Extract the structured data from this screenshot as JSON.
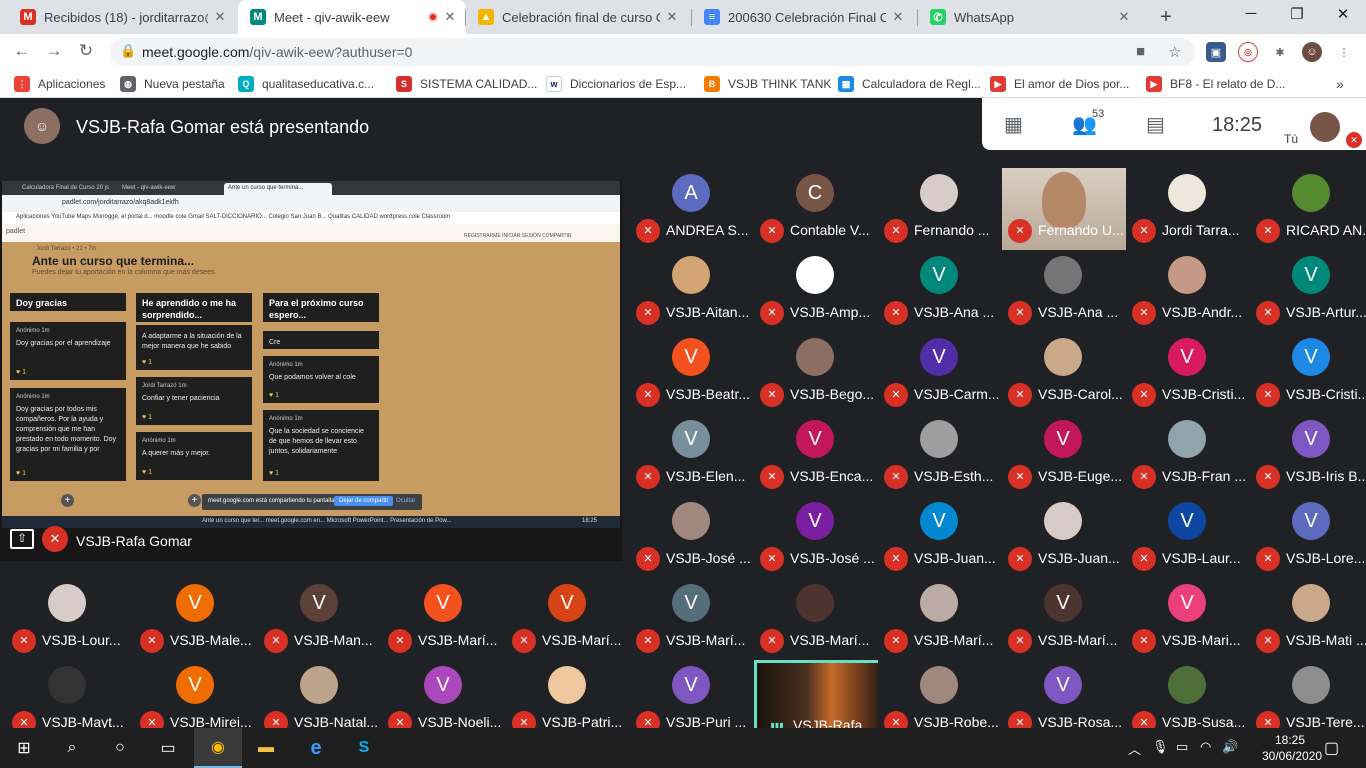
{
  "tabs": [
    {
      "title": "Recibidos (18) - jorditarrazo@",
      "icon": "gmail-icon",
      "fav": "M",
      "color": "#d93025",
      "active": false
    },
    {
      "title": "Meet - qiv-awik-eew",
      "icon": "meet-icon",
      "fav": "M",
      "color": "#00897b",
      "active": true
    },
    {
      "title": "Celebración final de curso ON",
      "icon": "drive-icon",
      "fav": "▲",
      "color": "#f4b400",
      "active": false
    },
    {
      "title": "200630 Celebración Final Curs",
      "icon": "docs-icon",
      "fav": "≡",
      "color": "#4285f4",
      "active": false
    },
    {
      "title": "WhatsApp",
      "icon": "whatsapp-icon",
      "fav": "✆",
      "color": "#25d366",
      "active": false
    }
  ],
  "address": {
    "host": "meet.google.com",
    "path": "/qiv-awik-eew?authuser=0"
  },
  "bookmarks": [
    {
      "label": "Aplicaciones",
      "color": "#ea4335",
      "g": "⋮"
    },
    {
      "label": "Nueva pestaña",
      "color": "#5f6368",
      "g": "◍"
    },
    {
      "label": "qualitaseducativa.c...",
      "color": "#00acc1",
      "g": "Q"
    },
    {
      "label": "SISTEMA CALIDAD...",
      "color": "#d32f2f",
      "g": "S"
    },
    {
      "label": "Diccionarios de Esp...",
      "color": "#ffffff",
      "g": "w"
    },
    {
      "label": "VSJB THINK TANK",
      "color": "#f57c00",
      "g": "B"
    },
    {
      "label": "Calculadora de Regl...",
      "color": "#1e88e5",
      "g": "▦"
    },
    {
      "label": "El amor de Dios por...",
      "color": "#e53935",
      "g": "▶"
    },
    {
      "label": "BF8 - El relato de D...",
      "color": "#e53935",
      "g": "▶"
    }
  ],
  "meet": {
    "presenting_title": "VSJB-Rafa Gomar está presentando",
    "time": "18:25",
    "participants_count": "53",
    "self_label": "Tú",
    "presenter_label": "VSJB-Rafa Gomar"
  },
  "padlet": {
    "tabs": [
      "Calculadora Final de Curso 20 js",
      "Meet - qiv-awik-eew",
      "Ante un curso que termina..."
    ],
    "url": "padlet.com/jorditarrazo/akq8adk1ekfh",
    "bookmarks": "Aplicaciones  YouTube  Maps  Monogge, el portal d...  moodle cole  Gmail  SALT-DICCIONARIO...  Colegio San Juan B...  Qualitas  CALIDAD  wordpress cole  Classroom",
    "brand": "padlet",
    "author": "Jordi Tarrazó • 21 • 7m",
    "title": "Ante un curso que termina...",
    "subtitle": "Puedes dejar tu aportación en la columna que más desees.",
    "header_actions": "REGISTRARME   INICIAR SESIÓN   COMPARTIR",
    "columns": [
      {
        "head": "Doy gracias",
        "cards": [
          {
            "author": "Anónimo  1m",
            "text": "Doy gracias por el aprendizaje"
          },
          {
            "author": "Anónimo  1m",
            "text": "Doy gracias por todos mis compañeros. Por la ayuda y comprensión que me han prestado en todo momento. Doy gracias por mi familia y por"
          }
        ]
      },
      {
        "head": "He aprendido o me ha sorprendido...",
        "cards": [
          {
            "author": "",
            "text": "A adaptarme a la situación de la mejor manera que he sabido"
          },
          {
            "author": "Jordi Tarrazó  1m",
            "text": "Confiar y tener paciencia"
          },
          {
            "author": "Anónimo  1m",
            "text": "A querer más y mejor."
          }
        ]
      },
      {
        "head": "Para el próximo curso espero...",
        "cards": [
          {
            "author": "",
            "text": "Cre"
          },
          {
            "author": "Anónimo  1m",
            "text": "Que podamos volver al cole"
          },
          {
            "author": "Anónimo  1m",
            "text": "Que la sociedad se conciencie de que hemos de llevar esto juntos, solidariamente"
          }
        ]
      }
    ],
    "share_text": "meet.google.com está compartiendo tu pantalla.",
    "share_stop": "Dejar de compartir",
    "share_hide": "Ocultar",
    "taskbar": "Ante un curso que ter...   meet.google.com en...   Microsoft PowerPoint...   Presentación de Pow...",
    "taskbar_time": "18:25"
  },
  "participants": [
    {
      "name": "ANDREA S...",
      "letter": "A",
      "color": "#5c6bc0"
    },
    {
      "name": "Contable V...",
      "letter": "C",
      "color": "#795548"
    },
    {
      "name": "Fernando ...",
      "letter": "",
      "color": "#d7ccc8"
    },
    {
      "name": "Fernando U...",
      "letter": "",
      "color": "#c5b8a8",
      "video": true
    },
    {
      "name": "Jordi Tarra...",
      "letter": "",
      "color": "#efe6dc"
    },
    {
      "name": "RICARD AN...",
      "letter": "",
      "color": "#558b2f"
    },
    {
      "name": "VSJB-Aitan...",
      "letter": "",
      "color": "#d4a574"
    },
    {
      "name": "VSJB-Amp...",
      "letter": "",
      "color": "#ffffff"
    },
    {
      "name": "VSJB-Ana ...",
      "letter": "V",
      "color": "#00897b"
    },
    {
      "name": "VSJB-Ana ...",
      "letter": "",
      "color": "#757575"
    },
    {
      "name": "VSJB-Andr...",
      "letter": "",
      "color": "#c49a86"
    },
    {
      "name": "VSJB-Artur...",
      "letter": "V",
      "color": "#00897b"
    },
    {
      "name": "VSJB-Beatr...",
      "letter": "V",
      "color": "#f4511e"
    },
    {
      "name": "VSJB-Bego...",
      "letter": "",
      "color": "#8d6e63"
    },
    {
      "name": "VSJB-Carm...",
      "letter": "V",
      "color": "#512da8"
    },
    {
      "name": "VSJB-Carol...",
      "letter": "",
      "color": "#c9a989"
    },
    {
      "name": "VSJB-Cristi...",
      "letter": "V",
      "color": "#d81b60"
    },
    {
      "name": "VSJB-Cristi...",
      "letter": "V",
      "color": "#1e88e5"
    },
    {
      "name": "VSJB-Elen...",
      "letter": "V",
      "color": "#78909c"
    },
    {
      "name": "VSJB-Enca...",
      "letter": "V",
      "color": "#c2185b"
    },
    {
      "name": "VSJB-Esth...",
      "letter": "",
      "color": "#9e9e9e"
    },
    {
      "name": "VSJB-Euge...",
      "letter": "V",
      "color": "#c2185b"
    },
    {
      "name": "VSJB-Fran ...",
      "letter": "",
      "color": "#90a4ae"
    },
    {
      "name": "VSJB-Iris B...",
      "letter": "V",
      "color": "#7e57c2"
    },
    {
      "name": "VSJB-José ...",
      "letter": "",
      "color": "#a1887f"
    },
    {
      "name": "VSJB-José ...",
      "letter": "V",
      "color": "#7b1fa2"
    },
    {
      "name": "VSJB-Juan...",
      "letter": "V",
      "color": "#0288d1"
    },
    {
      "name": "VSJB-Juan...",
      "letter": "",
      "color": "#d7ccc8"
    },
    {
      "name": "VSJB-Laur...",
      "letter": "V",
      "color": "#0d47a1"
    },
    {
      "name": "VSJB-Lore...",
      "letter": "V",
      "color": "#5c6bc0"
    },
    {
      "name": "VSJB-Lour...",
      "letter": "",
      "color": "#d7ccc8"
    },
    {
      "name": "VSJB-Male...",
      "letter": "V",
      "color": "#ef6c00"
    },
    {
      "name": "VSJB-Man...",
      "letter": "V",
      "color": "#5d4037"
    },
    {
      "name": "VSJB-Marí...",
      "letter": "V",
      "color": "#f4511e"
    },
    {
      "name": "VSJB-Marí...",
      "letter": "V",
      "color": "#d84315"
    },
    {
      "name": "VSJB-Marí...",
      "letter": "V",
      "color": "#546e7a"
    },
    {
      "name": "VSJB-Marí...",
      "letter": "",
      "color": "#4e342e"
    },
    {
      "name": "VSJB-Marí...",
      "letter": "",
      "color": "#bcaaa4"
    },
    {
      "name": "VSJB-Marí...",
      "letter": "V",
      "color": "#4e342e"
    },
    {
      "name": "VSJB-Mari...",
      "letter": "V",
      "color": "#ec407a"
    },
    {
      "name": "VSJB-Mati ...",
      "letter": "",
      "color": "#c9a989"
    },
    {
      "name": "VSJB-Mayt...",
      "letter": "",
      "color": "#333333"
    },
    {
      "name": "VSJB-Mirei...",
      "letter": "V",
      "color": "#ef6c00"
    },
    {
      "name": "VSJB-Natal...",
      "letter": "",
      "color": "#bca58a"
    },
    {
      "name": "VSJB-Noeli...",
      "letter": "V",
      "color": "#ab47bc"
    },
    {
      "name": "VSJB-Patri...",
      "letter": "",
      "color": "#f0c8a0"
    },
    {
      "name": "VSJB-Puri ...",
      "letter": "V",
      "color": "#7e57c2"
    },
    {
      "name": "VSJB-Rafa ...",
      "letter": "",
      "color": "#3a2a1e",
      "video": true,
      "highlight": true
    },
    {
      "name": "VSJB-Robe...",
      "letter": "",
      "color": "#a1887f"
    },
    {
      "name": "VSJB-Rosa...",
      "letter": "V",
      "color": "#7e57c2"
    },
    {
      "name": "VSJB-Susa...",
      "letter": "",
      "color": "#4e6e3a"
    },
    {
      "name": "VSJB-Tere...",
      "letter": "",
      "color": "#8d8d8d"
    }
  ],
  "taskbar": {
    "apps": [
      {
        "name": "start-button",
        "glyph": "⊞"
      },
      {
        "name": "search-taskbar-icon",
        "glyph": "⌕"
      },
      {
        "name": "cortana-icon",
        "glyph": "○"
      },
      {
        "name": "task-view-icon",
        "glyph": "▭"
      },
      {
        "name": "chrome-taskbar-icon",
        "glyph": "◉",
        "active": true
      },
      {
        "name": "explorer-taskbar-icon",
        "glyph": "▬"
      },
      {
        "name": "edge-taskbar-icon",
        "glyph": "e"
      },
      {
        "name": "skype-taskbar-icon",
        "glyph": "S"
      }
    ],
    "time": "18:25",
    "date": "30/06/2020"
  }
}
